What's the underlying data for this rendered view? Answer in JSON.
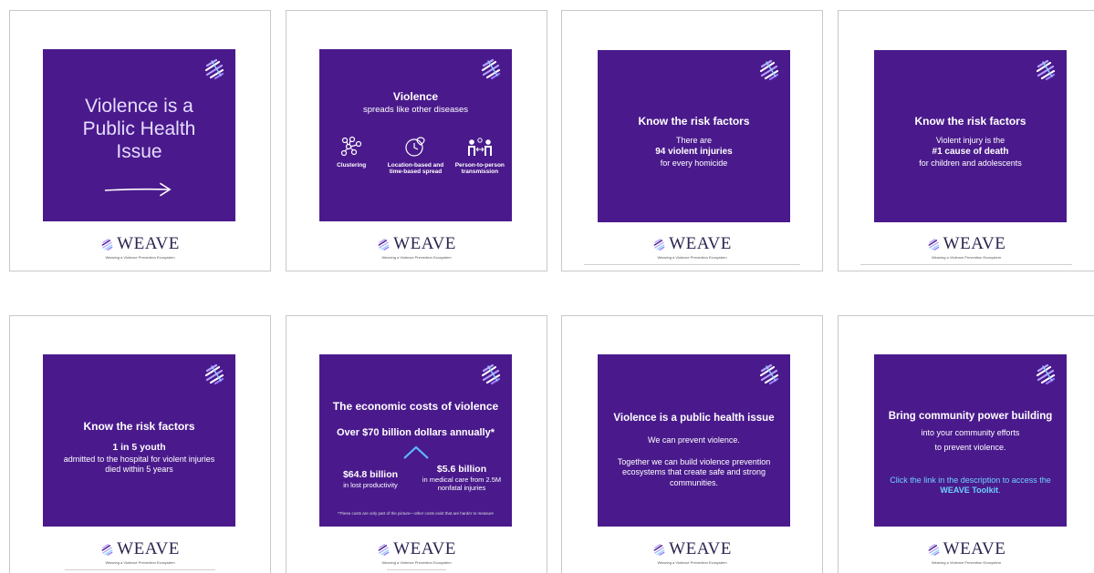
{
  "brand": {
    "name": "WEAVE",
    "tagline": "Weaving a Violence Prevention Ecosystem"
  },
  "colors": {
    "slide_bg": "#4a1a8c",
    "accent_link": "#6fd0ff",
    "brand_text": "#2a2450",
    "card_border": "#c8c8c8"
  },
  "icons": {
    "logo": "weave-swirl-logo-icon",
    "clustering": "cluster-network-icon",
    "location": "location-clock-icon",
    "person": "person-to-person-icon",
    "arrow": "right-arrow-icon",
    "chevron": "chevron-up-icon"
  },
  "slides": [
    {
      "title": "Violence is a Public Health Issue"
    },
    {
      "title": "Violence",
      "subtitle": "spreads like other diseases",
      "items": [
        {
          "label": "Clustering"
        },
        {
          "label": "Location-based and time-based spread"
        },
        {
          "label": "Person-to-person transmission"
        }
      ]
    },
    {
      "title": "Know the risk factors",
      "line1": "There are",
      "line2": "94 violent injuries",
      "line3": "for every homicide"
    },
    {
      "title": "Know the risk factors",
      "line1": "Violent injury is the",
      "line2": "#1 cause of death",
      "line3": "for children and adolescents"
    },
    {
      "title": "Know the risk factors",
      "line1": "1 in 5 youth",
      "line2": "admitted to the hospital for violent injuries",
      "line3": "died within 5 years"
    },
    {
      "title": "The economic costs of violence",
      "headline": "Over $70 billion dollars annually*",
      "left_value": "$64.8 billion",
      "left_label": "in lost productivity",
      "right_value": "$5.6 billion",
      "right_label": "in medical care from 2.5M nonfatal injuries",
      "footnote": "*These costs are only part of the picture—other costs exist that are harder to measure"
    },
    {
      "title": "Violence is a public health issue",
      "line1": "We can prevent violence.",
      "line2": "Together we can build violence prevention ecosystems that create safe and strong communities."
    },
    {
      "title": "Bring community power building",
      "line1": "into your community efforts",
      "line2": "to prevent violence.",
      "link_text": "Click the link in the description to access the ",
      "link_bold": "WEAVE Toolkit",
      "link_end": "."
    }
  ]
}
